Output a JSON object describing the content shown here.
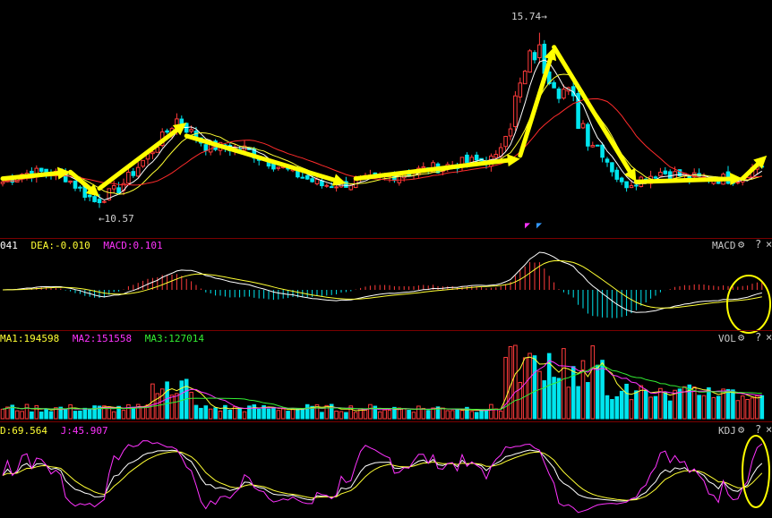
{
  "price": {
    "high_label": "15.74",
    "low_label": "10.57",
    "ylim": [
      9.6,
      16.6
    ]
  },
  "macd": {
    "title": "MACD",
    "dif_label": "041",
    "dea_label": "DEA:-0.010",
    "macd_label": "MACD:0.101"
  },
  "vol": {
    "title": "VOL",
    "ma1_label": "MA1:194598",
    "ma2_label": "MA2:151558",
    "ma3_label": "MA3:127014"
  },
  "kdj": {
    "title": "KDJ",
    "d_label": "D:69.564",
    "j_label": "J:45.907"
  },
  "controls": {
    "gear": "⚙",
    "help": "?",
    "close": "×"
  },
  "colors": {
    "up": "#ff3b3b",
    "down": "#00e5ee",
    "ma_white": "#ffffff",
    "ma_yellow": "#ffff33",
    "ma_red": "#ff2b2b",
    "ma_green": "#33ee33",
    "ma_magenta": "#ff33ff",
    "arrow": "#ffff00",
    "circle": "#ffff00"
  },
  "chart_data": {
    "type": "candlestick",
    "price_key_points": [
      {
        "i": 0,
        "p": 11.2
      },
      {
        "i": 4,
        "p": 11.45
      },
      {
        "i": 9,
        "p": 11.5
      },
      {
        "i": 13,
        "p": 11.35
      },
      {
        "i": 19,
        "p": 10.6
      },
      {
        "i": 24,
        "p": 11.0
      },
      {
        "i": 30,
        "p": 12.0
      },
      {
        "i": 36,
        "p": 13.1
      },
      {
        "i": 42,
        "p": 12.3
      },
      {
        "i": 50,
        "p": 12.2
      },
      {
        "i": 58,
        "p": 11.6
      },
      {
        "i": 66,
        "p": 11.1
      },
      {
        "i": 74,
        "p": 11.2
      },
      {
        "i": 84,
        "p": 11.5
      },
      {
        "i": 96,
        "p": 11.8
      },
      {
        "i": 102,
        "p": 11.9
      },
      {
        "i": 106,
        "p": 13.6
      },
      {
        "i": 110,
        "p": 15.2
      },
      {
        "i": 114,
        "p": 14.5
      },
      {
        "i": 119,
        "p": 13.2
      },
      {
        "i": 124,
        "p": 12.1
      },
      {
        "i": 128,
        "p": 11.1
      },
      {
        "i": 136,
        "p": 11.5
      },
      {
        "i": 144,
        "p": 11.3
      },
      {
        "i": 152,
        "p": 11.3
      },
      {
        "i": 156,
        "p": 11.7
      }
    ],
    "annotations": [
      "15.74",
      "10.57"
    ]
  }
}
